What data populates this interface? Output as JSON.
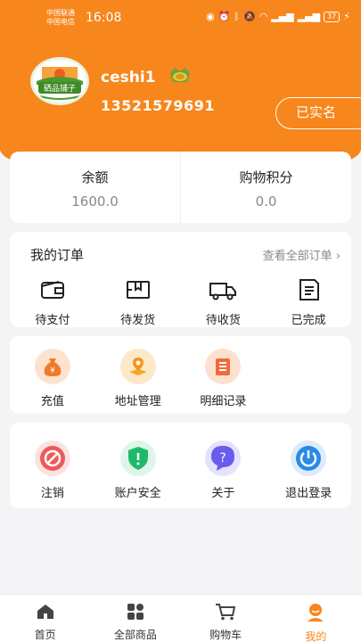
{
  "status_bar": {
    "carrier1": "中国联通",
    "carrier2": "中国电信",
    "time": "16:08",
    "battery": "37"
  },
  "profile": {
    "avatar_logo_text": "硒品铺子",
    "username": "ceshi1",
    "phone": "13521579691",
    "verify_button": "已实名"
  },
  "balance": {
    "items": [
      {
        "label": "余额",
        "value": "1600.0"
      },
      {
        "label": "购物积分",
        "value": "0.0"
      }
    ]
  },
  "orders": {
    "title": "我的订单",
    "view_all": "查看全部订单",
    "items": [
      {
        "label": "待支付",
        "icon": "wallet-icon"
      },
      {
        "label": "待发货",
        "icon": "package-icon"
      },
      {
        "label": "待收货",
        "icon": "truck-icon"
      },
      {
        "label": "已完成",
        "icon": "document-icon"
      }
    ]
  },
  "services": {
    "items": [
      {
        "label": "充值",
        "icon": "money-bag-icon"
      },
      {
        "label": "地址管理",
        "icon": "location-pin-icon"
      },
      {
        "label": "明细记录",
        "icon": "list-icon"
      }
    ]
  },
  "settings": {
    "items": [
      {
        "label": "注销",
        "icon": "forbidden-icon"
      },
      {
        "label": "账户安全",
        "icon": "shield-icon"
      },
      {
        "label": "关于",
        "icon": "question-icon"
      },
      {
        "label": "退出登录",
        "icon": "power-icon"
      }
    ]
  },
  "tabbar": {
    "items": [
      {
        "label": "首页",
        "icon": "home-icon",
        "active": false
      },
      {
        "label": "全部商品",
        "icon": "grid-icon",
        "active": false
      },
      {
        "label": "购物车",
        "icon": "cart-icon",
        "active": false
      },
      {
        "label": "我的",
        "icon": "user-icon",
        "active": true
      }
    ]
  },
  "colors": {
    "accent": "#f7861c",
    "background": "#f4f4f6"
  }
}
